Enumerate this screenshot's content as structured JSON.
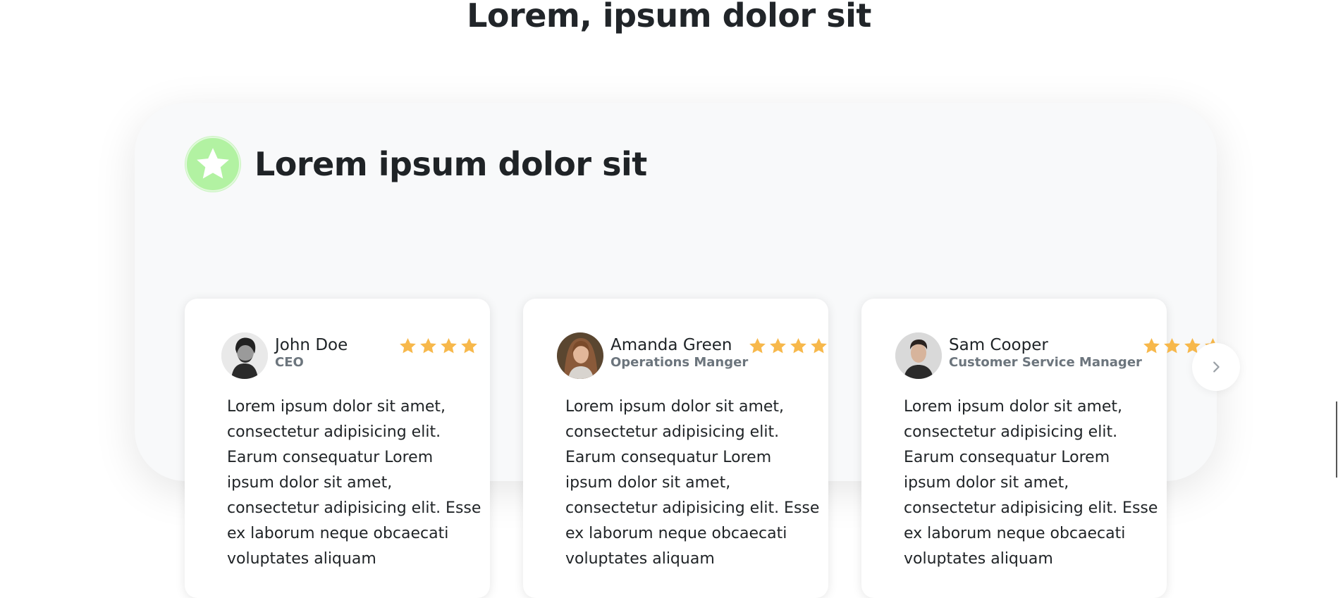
{
  "page": {
    "title": "Lorem, ipsum dolor sit"
  },
  "section": {
    "title": "Lorem ipsum dolor sit",
    "badge_icon": "star-icon",
    "badge_color": "#b2f2a2"
  },
  "testimonials": [
    {
      "name": "John Doe",
      "role": "CEO",
      "rating": 4,
      "text": "Lorem ipsum dolor sit amet, consectetur adipisicing elit. Earum consequatur Lorem ipsum dolor sit amet, consectetur adipisicing elit. Esse ex laborum neque obcaecati voluptates aliquam"
    },
    {
      "name": "Amanda Green",
      "role": "Operations Manger",
      "rating": 4,
      "text": "Lorem ipsum dolor sit amet, consectetur adipisicing elit. Earum consequatur Lorem ipsum dolor sit amet, consectetur adipisicing elit. Esse ex laborum neque obcaecati voluptates aliquam"
    },
    {
      "name": "Sam Cooper",
      "role": "Customer Service Manager",
      "rating": 4,
      "text": "Lorem ipsum dolor sit amet, consectetur adipisicing elit. Earum consequatur Lorem ipsum dolor sit amet, consectetur adipisicing elit. Esse ex laborum neque obcaecati voluptates aliquam"
    }
  ],
  "carousel": {
    "next_icon": "chevron-right-icon"
  },
  "colors": {
    "star": "#f7b84b",
    "panel_bg": "#f8f9fa",
    "text": "#212529",
    "muted": "#6c757d"
  }
}
